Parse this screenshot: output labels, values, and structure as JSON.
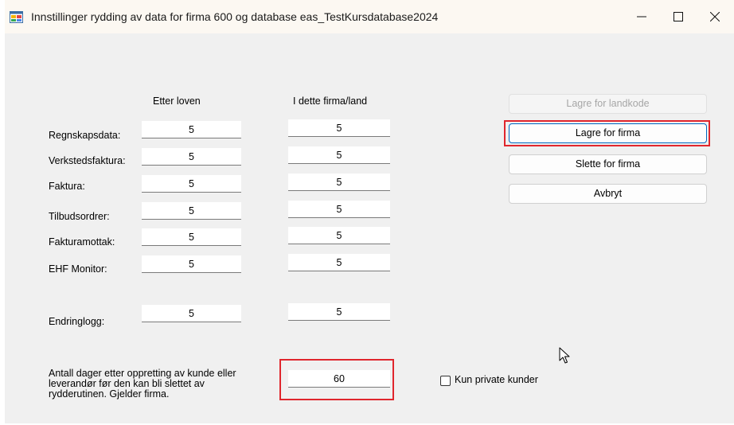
{
  "window": {
    "title": "Innstillinger rydding av data for firma 600 og database eas_TestKursdatabase2024",
    "icon": "app-window-icon",
    "controls": {
      "minimize": "—",
      "maximize": "☐",
      "close": "✕"
    }
  },
  "columns": {
    "law": "Etter loven",
    "firm": "I dette firma/land"
  },
  "rows": [
    {
      "label": "Regnskapsdata:",
      "law": "5",
      "firm": "5"
    },
    {
      "label": "Verkstedsfaktura:",
      "law": "5",
      "firm": "5"
    },
    {
      "label": "Faktura:",
      "law": "5",
      "firm": "5"
    },
    {
      "label": "Tilbudsordrer:",
      "law": "5",
      "firm": "5"
    },
    {
      "label": "Fakturamottak:",
      "law": "5",
      "firm": "5"
    },
    {
      "label": "EHF Monitor:",
      "law": "5",
      "firm": "5"
    },
    {
      "label": "Endringlogg:",
      "law": "5",
      "firm": "5"
    }
  ],
  "days": {
    "description": "Antall dager etter oppretting av kunde eller leverandør før den kan bli slettet av rydderutinen. Gjelder firma.",
    "line1": "Antall dager etter oppretting av kunde eller",
    "line2": "leverandør før den kan bli slettet av",
    "line3": "rydderutinen. Gjelder firma.",
    "value": "60"
  },
  "buttons": {
    "save_country": "Lagre for landkode",
    "save_firm": "Lagre for firma",
    "delete_firm": "Slette for firma",
    "cancel": "Avbryt"
  },
  "checkbox": {
    "label": "Kun private kunder",
    "checked": false
  },
  "colors": {
    "highlight": "#e0262d",
    "focus": "#0067c0"
  }
}
